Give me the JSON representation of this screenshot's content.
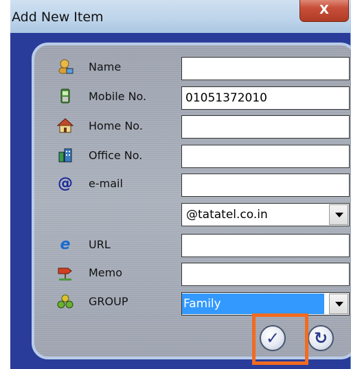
{
  "window": {
    "title": "Add New Item",
    "close_glyph": "X"
  },
  "form": {
    "rows": [
      {
        "label": "Name",
        "icon": "person-icon",
        "value": ""
      },
      {
        "label": "Mobile No.",
        "icon": "mobile-phone-icon",
        "value": "01051372010"
      },
      {
        "label": "Home No.",
        "icon": "house-icon",
        "value": ""
      },
      {
        "label": "Office No.",
        "icon": "office-building-icon",
        "value": ""
      },
      {
        "label": "e-mail",
        "icon": "at-sign-icon",
        "value": ""
      }
    ],
    "email_domain": "@tatatel.co.in",
    "url": {
      "label": "URL",
      "icon": "browser-e-icon",
      "value": ""
    },
    "memo": {
      "label": "Memo",
      "icon": "signpost-icon",
      "value": ""
    },
    "group": {
      "label": "GROUP",
      "icon": "group-people-icon",
      "selected": "Family"
    }
  },
  "buttons": {
    "confirm": {
      "glyph": "✓",
      "icon": "checkmark-icon"
    },
    "reset": {
      "glyph": "↻",
      "icon": "refresh-icon"
    }
  },
  "colors": {
    "panel_border": "#b9cce9",
    "client_background": "#2a3c9a",
    "highlight": "#f26b20",
    "selection": "#3399ff"
  }
}
